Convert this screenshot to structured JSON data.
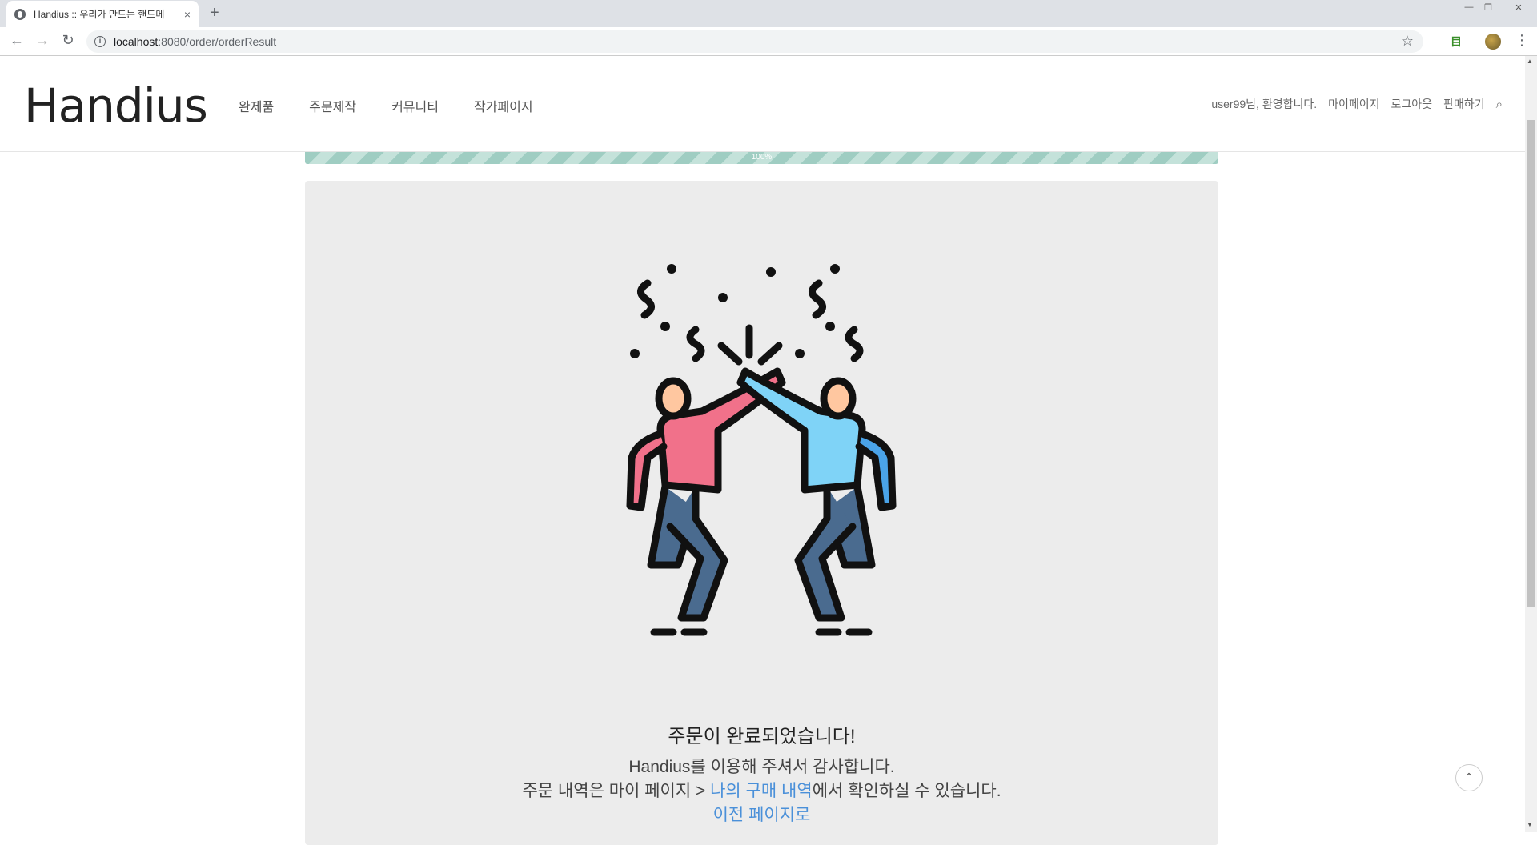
{
  "browser": {
    "tab_title": "Handius :: 우리가 만드는 핸드메",
    "tab_close": "×",
    "new_tab": "+",
    "url_host": "localhost",
    "url_path": ":8080/order/orderResult",
    "info_glyph": "i",
    "star_glyph": "☆",
    "menu_glyph": "⋮",
    "back_glyph": "←",
    "forward_glyph": "→",
    "reload_glyph": "↻",
    "extension_glyph": "目",
    "window_controls": {
      "minimize": "—",
      "maximize": "❐",
      "close": "✕"
    }
  },
  "header": {
    "logo": "Handius",
    "nav": [
      "완제품",
      "주문제작",
      "커뮤니티",
      "작가페이지"
    ],
    "user_greeting": "user99님, 환영합니다.",
    "mypage": "마이페이지",
    "logout": "로그아웃",
    "sell": "판매하기",
    "search_glyph": "⌕"
  },
  "progress": {
    "label": "100%",
    "value": 1.0
  },
  "result": {
    "title": "주문이 완료되었습니다!",
    "thanks": "Handius를 이용해 주셔서 감사합니다.",
    "history_prefix": "주문 내역은 마이 페이지 > ",
    "history_link": "나의 구매 내역",
    "history_suffix": "에서 확인하실 수 있습니다.",
    "back_link": "이전 페이지로"
  },
  "scroll_top_glyph": "⌃",
  "colors": {
    "link": "#4a90d9",
    "panel_bg": "#ececec",
    "progress": "#9fcdc2",
    "person_left_shirt": "#f1718a",
    "person_right_shirt": "#7fd3f7",
    "pants": "#4a6b8f"
  }
}
